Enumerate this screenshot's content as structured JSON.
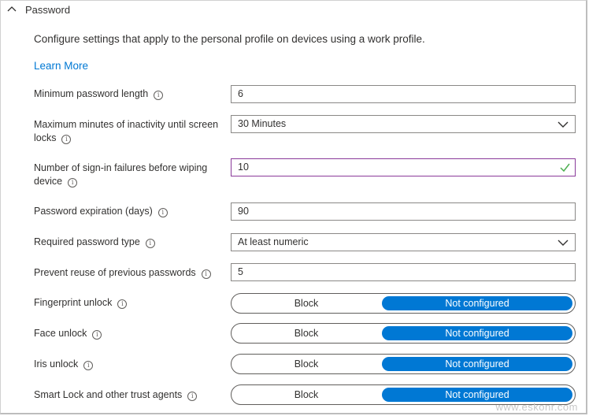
{
  "section": {
    "title": "Password"
  },
  "description": "Configure settings that apply to the personal profile on devices using a work profile.",
  "learn_more": "Learn More",
  "fields": {
    "min_length": {
      "label": "Minimum password length",
      "value": "6"
    },
    "inactivity": {
      "label_line1": "Maximum minutes of inactivity until screen",
      "label_line2": "locks",
      "value": "30 Minutes"
    },
    "signin_failures": {
      "label_line1": "Number of sign-in failures before wiping",
      "label_line2": "device",
      "value": "10"
    },
    "expiration": {
      "label": "Password expiration (days)",
      "value": "90"
    },
    "password_type": {
      "label": "Required password type",
      "value": "At least numeric"
    },
    "prevent_reuse": {
      "label": "Prevent reuse of previous passwords",
      "value": "5"
    }
  },
  "toggles": {
    "fingerprint": {
      "label": "Fingerprint unlock",
      "off_label": "Block",
      "on_label": "Not configured"
    },
    "face": {
      "label": "Face unlock",
      "off_label": "Block",
      "on_label": "Not configured"
    },
    "iris": {
      "label": "Iris unlock",
      "off_label": "Block",
      "on_label": "Not configured"
    },
    "smart_lock": {
      "label": "Smart Lock and other trust agents",
      "off_label": "Block",
      "on_label": "Not configured"
    }
  },
  "watermark": "www.eskonr.com",
  "colors": {
    "accent": "#0078d4",
    "valid_check": "#4caf50",
    "valid_border": "#8a3a9a"
  },
  "icons": {
    "collapse": "chevron-up-icon",
    "info": "info-icon",
    "dropdown": "chevron-down-icon",
    "valid": "checkmark-icon"
  }
}
